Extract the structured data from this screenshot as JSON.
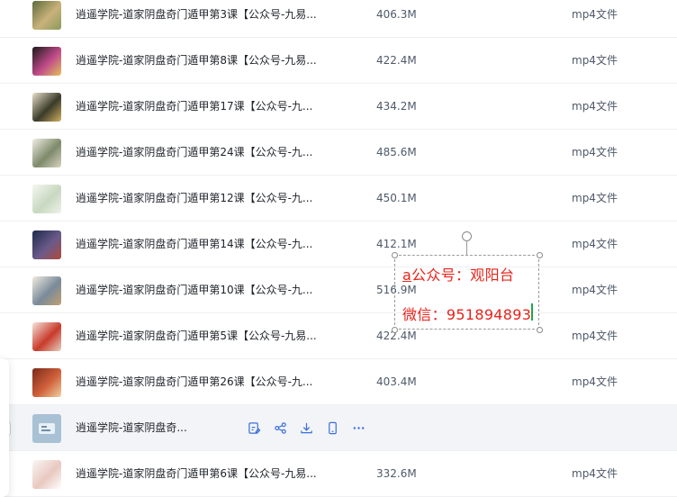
{
  "files": [
    {
      "name": "逍遥学院-道家阴盘奇门遁甲第3课【公众号-九易...",
      "size": "406.3M",
      "type": "mp4文件",
      "thumb": [
        "#5d6b3c",
        "#c9b27a",
        "#8a9a5b"
      ]
    },
    {
      "name": "逍遥学院-道家阴盘奇门遁甲第8课【公众号-九易...",
      "size": "422.4M",
      "type": "mp4文件",
      "thumb": [
        "#1a1a1a",
        "#c04a8a",
        "#e2c25a"
      ]
    },
    {
      "name": "逍遥学院-道家阴盘奇门遁甲第17课【公众号-九...",
      "size": "434.2M",
      "type": "mp4文件",
      "thumb": [
        "#e8e0c8",
        "#3a3a2a",
        "#d0b060"
      ]
    },
    {
      "name": "逍遥学院-道家阴盘奇门遁甲第24课【公众号-九...",
      "size": "485.6M",
      "type": "mp4文件",
      "thumb": [
        "#f1eee6",
        "#7d8a6a",
        "#d9d3c2"
      ]
    },
    {
      "name": "逍遥学院-道家阴盘奇门遁甲第12课【公众号-九...",
      "size": "450.1M",
      "type": "mp4文件",
      "thumb": [
        "#f5f7f2",
        "#c8d8c0",
        "#eef2ea"
      ]
    },
    {
      "name": "逍遥学院-道家阴盘奇门遁甲第14课【公众号-九...",
      "size": "412.1M",
      "type": "mp4文件",
      "thumb": [
        "#1d2a4a",
        "#6a5a8a",
        "#b04a3a"
      ]
    },
    {
      "name": "逍遥学院-道家阴盘奇门遁甲第10课【公众号-九...",
      "size": "516.9M",
      "type": "mp4文件",
      "thumb": [
        "#f0ece0",
        "#7a8a9a",
        "#c0a070"
      ]
    },
    {
      "name": "逍遥学院-道家阴盘奇门遁甲第5课【公众号-九易...",
      "size": "422.4M",
      "type": "mp4文件",
      "thumb": [
        "#f5e6dc",
        "#c83a2a",
        "#e8d0c0"
      ]
    },
    {
      "name": "逍遥学院-道家阴盘奇门遁甲第26课【公众号-九...",
      "size": "403.4M",
      "type": "mp4文件",
      "thumb": [
        "#7a2a1a",
        "#d0603a",
        "#f0d0a0"
      ]
    },
    {
      "name": "逍遥学院-道家阴盘奇...",
      "size": "",
      "type": "",
      "thumb": [],
      "hover": true
    },
    {
      "name": "逍遥学院-道家阴盘奇门遁甲第6课【公众号-九易...",
      "size": "332.6M",
      "type": "mp4文件",
      "thumb": [
        "#fbf6f4",
        "#e8c8c0",
        "#fff"
      ]
    }
  ],
  "hover_actions": [
    "rename-icon",
    "share-icon",
    "download-icon",
    "phone-icon",
    "more-icon"
  ],
  "watermark": {
    "line1_prefix": "a",
    "line1": "公众号：观阳台",
    "line2": "微信：951894893",
    "color": "#e8231a"
  }
}
